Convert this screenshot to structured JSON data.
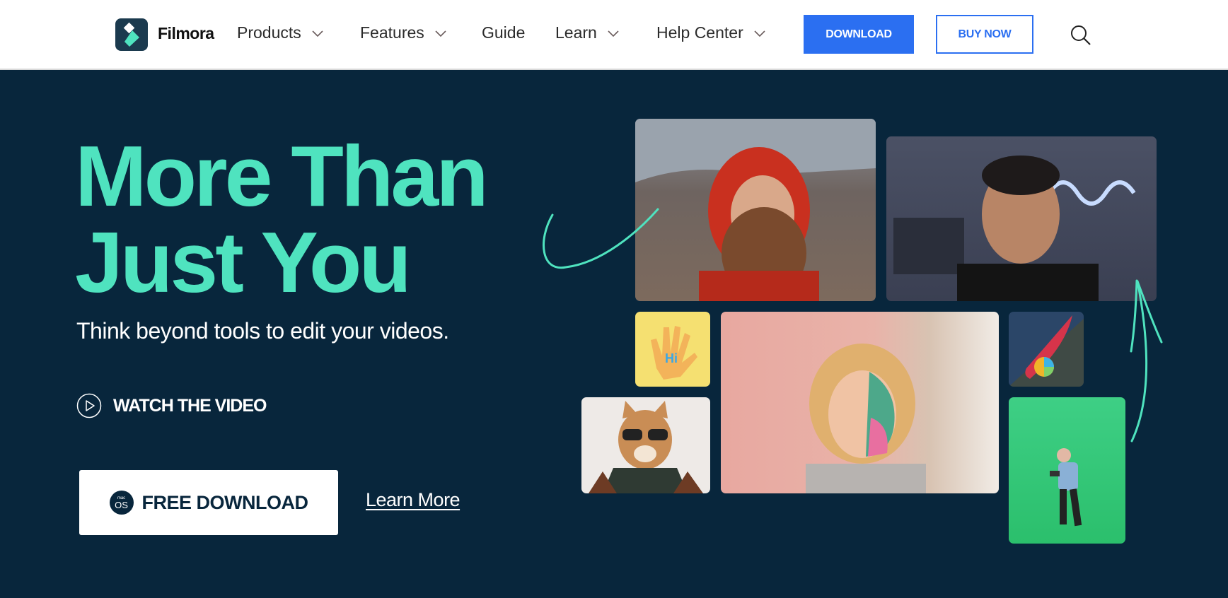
{
  "nav": {
    "brand": "Filmora",
    "items": [
      {
        "label": "Products",
        "has_dropdown": true
      },
      {
        "label": "Features",
        "has_dropdown": true
      },
      {
        "label": "Guide",
        "has_dropdown": false
      },
      {
        "label": "Learn",
        "has_dropdown": true
      },
      {
        "label": "Help Center",
        "has_dropdown": true
      }
    ],
    "download_label": "DOWNLOAD",
    "buy_label": "BUY NOW",
    "search_icon": "search-icon"
  },
  "hero": {
    "headline_line1": "More Than",
    "headline_line2": "Just You",
    "subtitle": "Think beyond tools to edit your videos.",
    "watch_label": "WATCH THE VIDEO",
    "free_download_label": "FREE DOWNLOAD",
    "os_badge_small": "mac",
    "os_badge_large": "OS",
    "learn_more_label": "Learn More"
  },
  "media_tiles": [
    {
      "name": "hiker-selfie",
      "desc": "Bearded man in red hood"
    },
    {
      "name": "vlogger-neon",
      "desc": "Man smiling with neon wave sign"
    },
    {
      "name": "hi-hand-sticker",
      "desc": "Waving hand with Hi"
    },
    {
      "name": "face-paint-woman",
      "desc": "Woman with half-face paint effect"
    },
    {
      "name": "boat-aerial",
      "desc": "Aerial view of red boat"
    },
    {
      "name": "dog-sunglasses",
      "desc": "Dog wearing sunglasses"
    },
    {
      "name": "green-screen-dancer",
      "desc": "Person on green screen"
    }
  ],
  "colors": {
    "accent": "#4fe3bf",
    "primary_blue": "#2b6ff1",
    "hero_bg": "#08263c"
  }
}
